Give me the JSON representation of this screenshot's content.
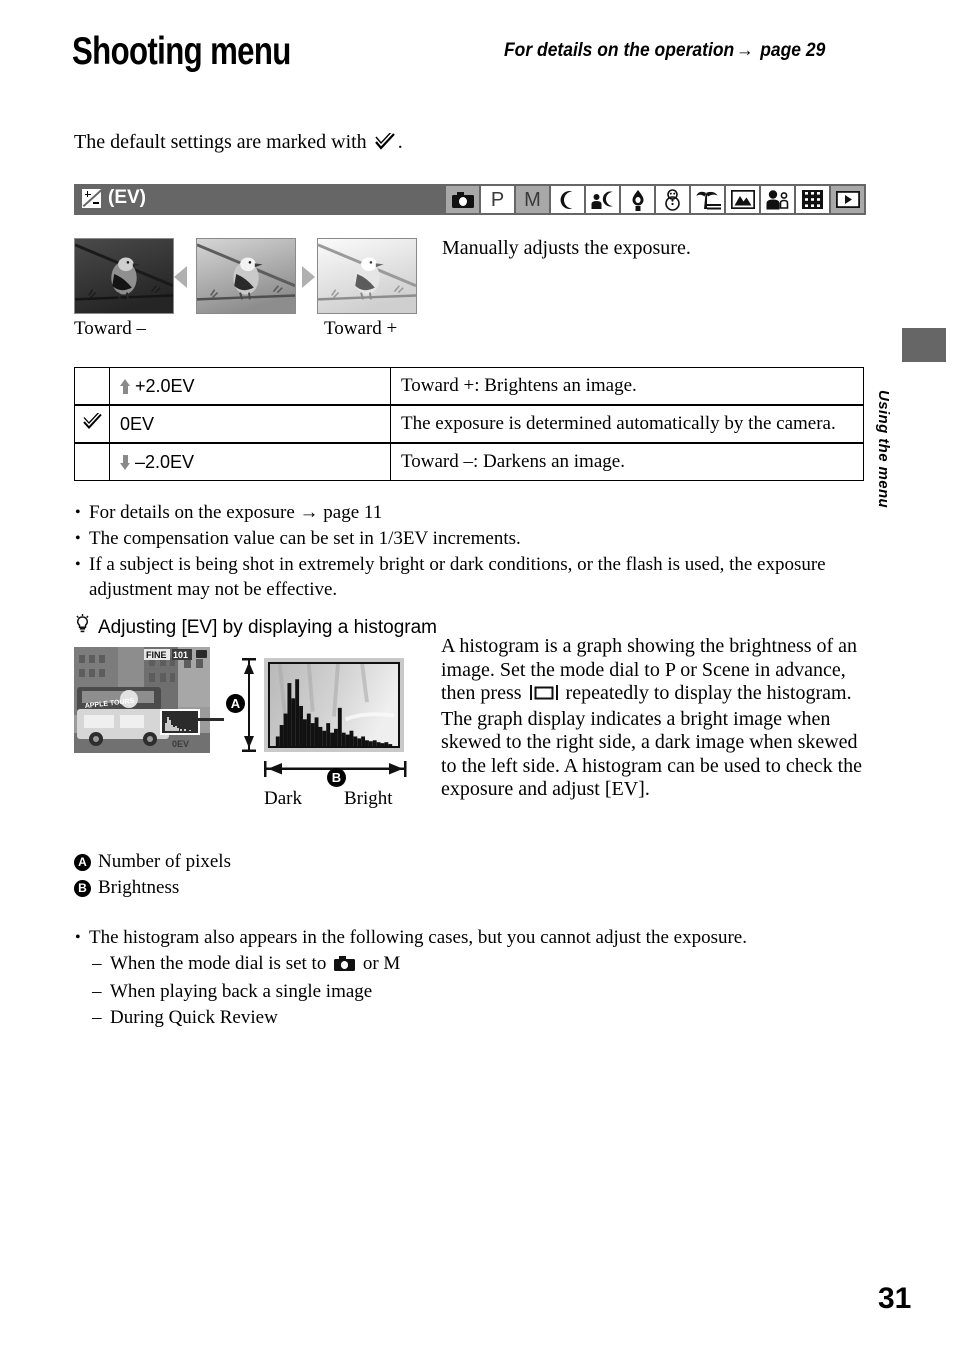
{
  "header": {
    "title": "Shooting menu",
    "details_note_prefix": "For details on the operation",
    "details_note_arrow": "→",
    "details_note_page": "page 29"
  },
  "intro": {
    "default_settings_prefix": "The default settings are marked with",
    "default_settings_suffix": "."
  },
  "mode_bar": {
    "setting_label": "(EV)",
    "setting_icon": "exposure-compensation-icon",
    "icons": [
      {
        "name": "still-camera-icon",
        "label": "",
        "state": "dim"
      },
      {
        "name": "program-mode-icon",
        "label": "P",
        "state": "active"
      },
      {
        "name": "manual-mode-icon",
        "label": "M",
        "state": "dim"
      },
      {
        "name": "twilight-mode-icon",
        "label": "",
        "state": "active"
      },
      {
        "name": "twilight-portrait-mode-icon",
        "label": "",
        "state": "active"
      },
      {
        "name": "candle-mode-icon",
        "label": "",
        "state": "active"
      },
      {
        "name": "snow-mode-icon",
        "label": "",
        "state": "active"
      },
      {
        "name": "beach-mode-icon",
        "label": "",
        "state": "active"
      },
      {
        "name": "landscape-mode-icon",
        "label": "",
        "state": "active"
      },
      {
        "name": "soft-snap-mode-icon",
        "label": "",
        "state": "active"
      },
      {
        "name": "movie-mode-icon",
        "label": "",
        "state": "active"
      },
      {
        "name": "playback-mode-icon",
        "label": "",
        "state": "dim"
      }
    ]
  },
  "sample": {
    "toward_minus": "Toward –",
    "toward_plus": "Toward +",
    "description": "Manually adjusts the exposure.",
    "left_arrow_icon": "left-triangle-icon",
    "right_arrow_icon": "right-triangle-icon"
  },
  "ev_table": {
    "rows": [
      {
        "checked": false,
        "arrow": "up",
        "value": "+2.0EV",
        "description": "Toward +: Brightens an image."
      },
      {
        "checked": true,
        "arrow": "none",
        "value": "0EV",
        "description": "The exposure is determined automatically by the camera."
      },
      {
        "checked": false,
        "arrow": "down",
        "value": "–2.0EV",
        "description": "Toward –: Darkens an image."
      }
    ]
  },
  "notes_top": [
    {
      "text_before": "For details on the exposure",
      "arrow": "→",
      "text_after": "page 11"
    },
    {
      "text": "The compensation value can be set in 1/3EV increments."
    },
    {
      "text": "If a subject is being shot in extremely bright or dark conditions, or the flash is used, the exposure adjustment may not be effective."
    }
  ],
  "tip": {
    "icon": "light-bulb-icon",
    "heading": "Adjusting [EV] by displaying a histogram",
    "paragraph_part1": "A histogram is a graph showing the brightness of an image. Set the mode dial to P or Scene in advance, then press",
    "paragraph_button_icon": "display-button-icon",
    "paragraph_part2": "repeatedly to display the histogram. The graph display indicates a bright image when skewed to the right side, a dark image when skewed to the left side. A histogram can be used to check the exposure and adjust [EV].",
    "diagram": {
      "badge_a": "A",
      "badge_b": "B",
      "dark_label": "Dark",
      "bright_label": "Bright",
      "lcd_overlay_fine": "FINE",
      "lcd_overlay_count": "101",
      "lcd_overlay_ev": "0EV",
      "lcd_overlay_bus": "APPLE TOURS"
    },
    "legend": [
      {
        "badge": "A",
        "text": "Number of pixels"
      },
      {
        "badge": "B",
        "text": "Brightness"
      }
    ]
  },
  "notes_bottom": {
    "lead": "The histogram also appears in the following cases, but you cannot adjust the exposure.",
    "items": [
      {
        "text_before": "When the mode dial is set to",
        "icon": "still-camera-icon",
        "text_after": "or M"
      },
      {
        "text": "When playing back a single image"
      },
      {
        "text": "During Quick Review"
      }
    ]
  },
  "side_tab": {
    "label": "Using the menu"
  },
  "footer": {
    "page_number": "31"
  },
  "colors": {
    "bar_gray": "#666666",
    "dim_icon_gray": "#a8a8a8",
    "arrow_gray": "#b0b0b0"
  }
}
